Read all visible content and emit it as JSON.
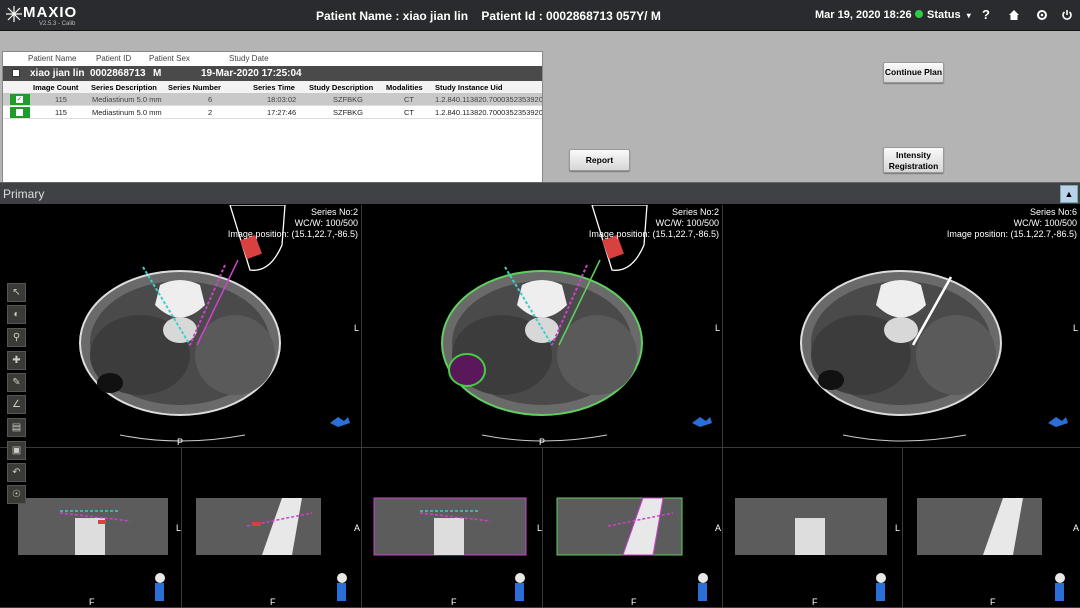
{
  "app": {
    "logo_text": "MAXIO",
    "version": "V2.5.3 - Calib"
  },
  "header": {
    "patient_name_label": "Patient Name : xiao jian lin",
    "patient_id_label": "Patient Id : 0002868713 057Y/ M",
    "datetime": "Mar 19, 2020 18:26",
    "status_label": "Status",
    "help_glyph": "?"
  },
  "study_browser": {
    "columns": [
      "Patient Name",
      "Patient ID",
      "Patient Sex",
      "Study Date"
    ],
    "patient_row": {
      "name": "xiao jian lin",
      "id": "0002868713",
      "sex": "M",
      "study_date": "19-Mar-2020 17:25:04"
    },
    "series_columns": [
      "Image Count",
      "Series Description",
      "Series Number",
      "Series Time",
      "Study Description",
      "Modalities",
      "Study Instance Uid"
    ],
    "series": [
      {
        "checked": true,
        "image_count": "115",
        "description": "Mediastinum 5.0 mm",
        "number": "6",
        "time": "18:03:02",
        "study_description": "SZFBKG",
        "modality": "CT",
        "uid": "1.2.840.113820.70003523539201"
      },
      {
        "checked": false,
        "image_count": "115",
        "description": "Mediastinum 5.0 mm",
        "number": "2",
        "time": "17:27:46",
        "study_description": "SZFBKG",
        "modality": "CT",
        "uid": "1.2.840.113820.70003523539201"
      }
    ]
  },
  "buttons": {
    "continue_plan": "Continue Plan",
    "report": "Report",
    "intensity_line1": "Intensity",
    "intensity_line2": "Registration"
  },
  "primary_bar": {
    "label": "Primary"
  },
  "viewports": {
    "axial": [
      {
        "series": "Series No:2",
        "wcww": "WC/W: 100/500",
        "position": "Image position: (15.1,22.7,-86.5)"
      },
      {
        "series": "Series No:2",
        "wcww": "WC/W: 100/500",
        "position": "Image position: (15.1,22.7,-86.5)"
      },
      {
        "series": "Series No:6",
        "wcww": "WC/W: 100/500",
        "position": "Image position: (15.1,22.7,-86.5)"
      }
    ],
    "orientation": {
      "left": "L",
      "posterior": "P",
      "anterior": "A",
      "foot": "F"
    }
  },
  "colors": {
    "accent_green": "#1f9c2c",
    "status_green": "#2ecc40",
    "needle_red": "#d94040",
    "magenta": "#d040d0",
    "cyan": "#3fd0c8"
  }
}
